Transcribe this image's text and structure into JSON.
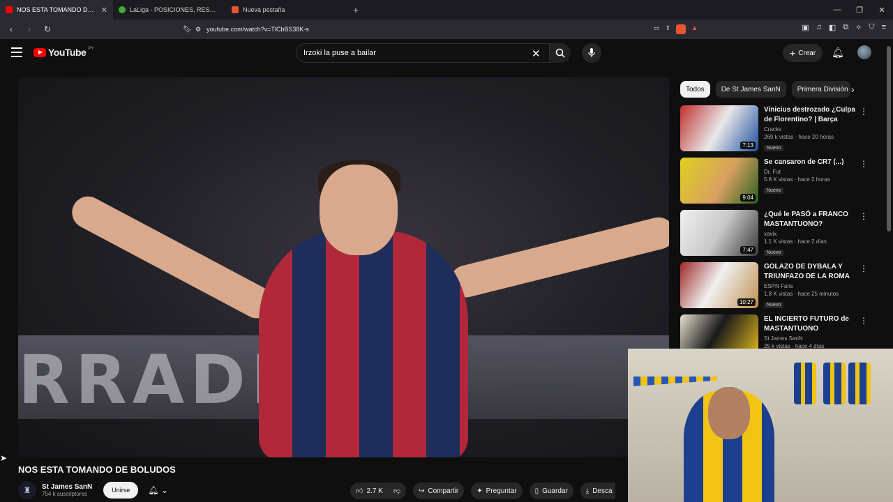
{
  "browser": {
    "tabs": [
      {
        "title": "NOS ESTA TOMANDO DE BOLUDOS",
        "active": true,
        "icon": "youtube-icon"
      },
      {
        "title": "LaLiga - POSICIONES, RESULTADOS Y",
        "active": false,
        "icon": "laliga-icon"
      },
      {
        "title": "Nueva pestaña",
        "active": false,
        "icon": "brave-icon"
      }
    ],
    "url": "youtube.com/watch?v=TlCbBS38K-s"
  },
  "header": {
    "logo_text": "YouTube",
    "logo_country": "PY",
    "search_value": "Irzoki la puse a bailar",
    "create_label": "Crear"
  },
  "chips": [
    "Todos",
    "De St James SanN",
    "Primera División d"
  ],
  "recommendations": [
    {
      "title": "Vinicius destrozado ¿Culpa de Florentino? | Barça advierte s...",
      "channel": "Cracks",
      "meta": "269 k vistas · hace 20 horas",
      "badge": "Nuevo",
      "duration": "7:13",
      "color": "#7a2c2c"
    },
    {
      "title": "Se cansaron de CR7 (...)",
      "channel": "Dr. Fut",
      "meta": "5.8 K vistas · hace 2 horas",
      "badge": "Nuevo",
      "duration": "9:04",
      "color": "#c8b824"
    },
    {
      "title": "¿Qué le PASÓ a FRANCO MASTANTUONO?",
      "channel": "xavix",
      "meta": "1.1 K vistas · hace 2 días",
      "badge": "Nuevo",
      "duration": "7:47",
      "color": "#e8e8e8"
    },
    {
      "title": "GOLAZO DE DYBALA Y TRIUNFAZO DE LA ROMA PAR...",
      "channel": "ESPN Fans",
      "meta": "1.8 K vistas · hace 25 minutos",
      "badge": "Nuevo",
      "duration": "10:27",
      "color": "#9a2a2a"
    },
    {
      "title": "EL INCIERTO FUTURO de MASTANTUONO",
      "channel": "St James SanN",
      "meta": "25 k vistas · hace 4 días",
      "badge": "",
      "duration": "",
      "color": "#2a2a2a"
    }
  ],
  "video": {
    "title": "NOS ESTA TOMANDO DE BOLUDOS",
    "banner_text": "RRADE",
    "channel_name": "St James SanN",
    "subscribers": "754 k suscriptores",
    "join_label": "Unirse",
    "likes": "2.7 K",
    "share_label": "Compartir",
    "ask_label": "Preguntar",
    "save_label": "Guardar",
    "download_label": "Desca"
  }
}
